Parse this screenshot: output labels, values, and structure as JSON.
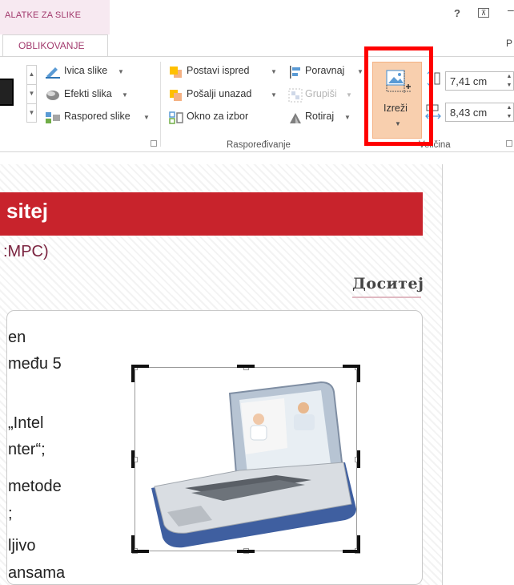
{
  "context_tab": {
    "title": "ALATKE ZA SLIKE",
    "tab_label": "OBLIKOVANJE"
  },
  "window": {
    "help": "?",
    "restore": "⊼",
    "minimize": "–",
    "edge_letter": "P"
  },
  "ribbon": {
    "picture_styles": {
      "border": "Ivica slike",
      "effects": "Efekti slika",
      "layout": "Raspored slike"
    },
    "arrange": {
      "bring_forward": "Postavi ispred",
      "send_backward": "Pošalji unazad",
      "selection_pane": "Okno za izbor",
      "align": "Poravnaj",
      "group": "Grupiši",
      "rotate": "Rotiraj",
      "group_label": "Raspoređivanje"
    },
    "size": {
      "crop_label": "Izreži",
      "height": "7,41 cm",
      "width": "8,43 cm",
      "group_label": "Veličina"
    }
  },
  "slide": {
    "title_fragment": "sitej",
    "subtitle_fragment": ":MPC)",
    "logo_text": "Доситеј",
    "body_lines": [
      "en",
      "među 5",
      "„Intel",
      "nter“;",
      " metode",
      ";",
      "ljivo",
      "ansama"
    ]
  },
  "colors": {
    "accent_tab": "#a23a6d",
    "title_bar": "#c8232c",
    "crop_button_bg": "#f8cfae",
    "highlight_box": "#ff0000"
  }
}
